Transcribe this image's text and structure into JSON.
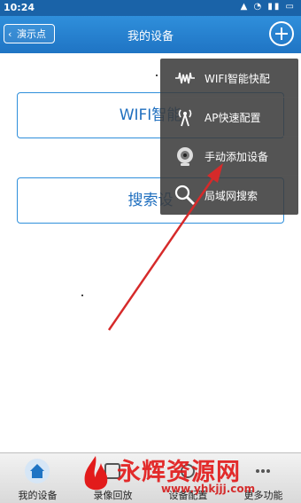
{
  "status_bar": {
    "time": "10:24"
  },
  "header": {
    "back_label": "演示点",
    "title": "我的设备",
    "add_icon": "plus-circle-icon"
  },
  "main": {
    "wifi_button_label": "WIFI智能",
    "search_button_label": "搜索设"
  },
  "menu": {
    "items": [
      {
        "label": "WIFI智能快配",
        "icon": "wifi-wave-icon"
      },
      {
        "label": "AP快速配置",
        "icon": "antenna-icon"
      },
      {
        "label": "手动添加设备",
        "icon": "camera-icon"
      },
      {
        "label": "局域网搜索",
        "icon": "magnifier-icon"
      }
    ]
  },
  "tabbar": {
    "tabs": [
      {
        "label": "我的设备"
      },
      {
        "label": "录像回放"
      },
      {
        "label": "设备配置"
      },
      {
        "label": "更多功能"
      }
    ]
  },
  "watermark": {
    "text": "永辉资源网",
    "url": "www.yhkjjj.com"
  },
  "colors": {
    "header": "#2f8fdb",
    "accent": "#1f6fbf",
    "arrow": "#d62a2a"
  }
}
